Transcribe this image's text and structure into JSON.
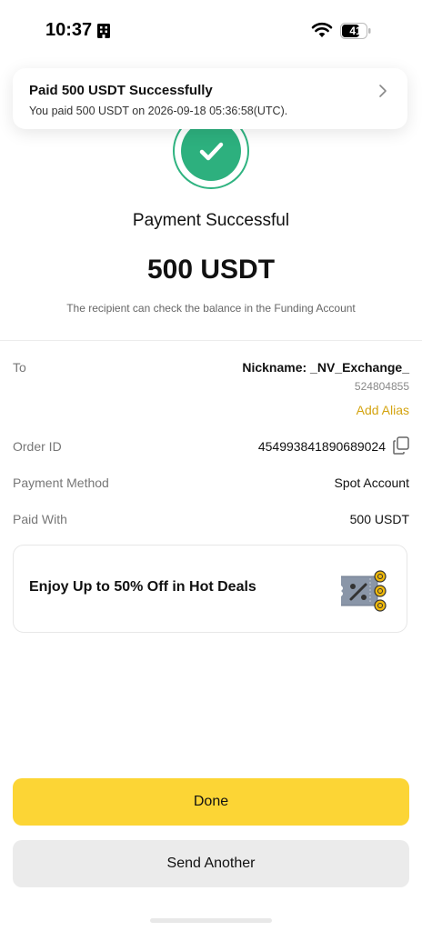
{
  "status_bar": {
    "time": "10:37",
    "battery": "41"
  },
  "notification": {
    "title": "Paid 500 USDT Successfully",
    "subtitle": "You paid 500 USDT on 2026-09-18 05:36:58(UTC)."
  },
  "hero": {
    "title": "Payment Successful",
    "amount": "500 USDT",
    "note": "The recipient can check the balance in the Funding Account"
  },
  "details": {
    "to_label": "To",
    "nickname": "Nickname: _NV_Exchange_",
    "recipient_id": "524804855",
    "add_alias": "Add Alias",
    "order_label": "Order ID",
    "order_id": "454993841890689024",
    "method_label": "Payment Method",
    "method_value": "Spot Account",
    "paid_label": "Paid With",
    "paid_value": "500 USDT"
  },
  "promo": {
    "text": "Enjoy Up to 50% Off in Hot Deals"
  },
  "buttons": {
    "done": "Done",
    "send_another": "Send Another"
  },
  "colors": {
    "accent_yellow": "#fcd535",
    "success_green": "#2db07e",
    "link_gold": "#d4a411"
  }
}
